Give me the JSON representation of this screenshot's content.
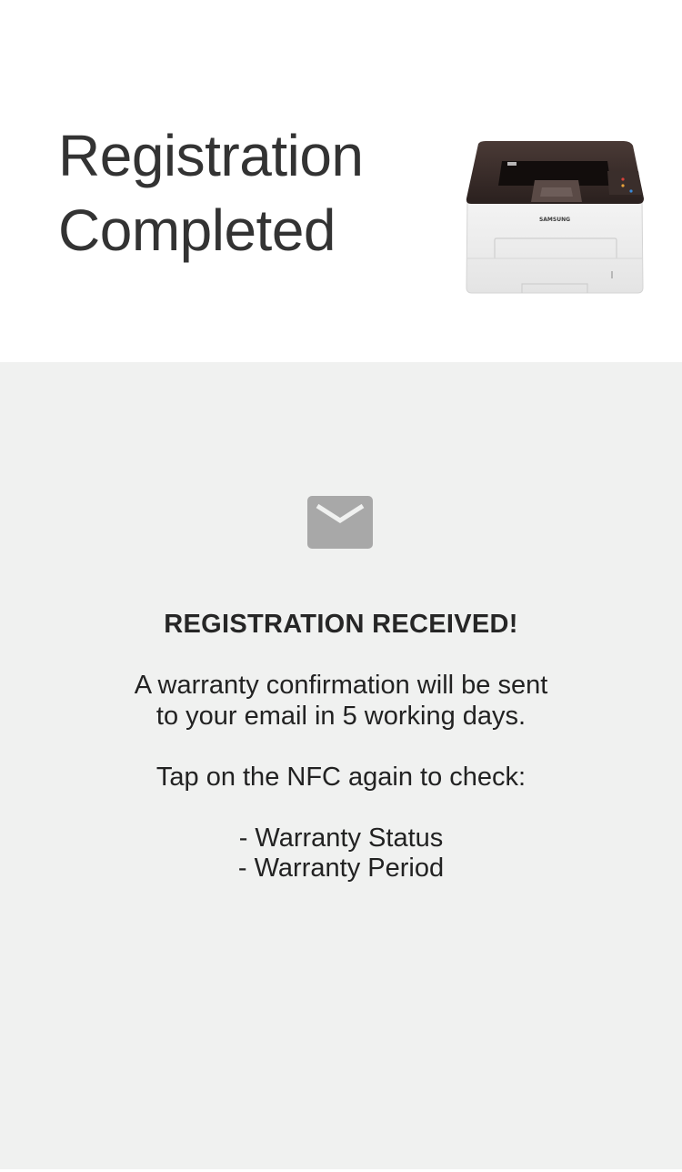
{
  "header": {
    "title_line1": "Registration",
    "title_line2": "Completed",
    "printer_image": {
      "icon": "printer-image",
      "brand_text": "SAMSUNG"
    }
  },
  "content": {
    "mail_icon": "mail-icon",
    "heading": "REGISTRATION RECEIVED!",
    "confirmation_line1": "A warranty confirmation will be sent",
    "confirmation_line2": "to your email in 5 working days.",
    "nfc_prompt": "Tap on the NFC again to check:",
    "check_items": [
      "- Warranty Status",
      "- Warranty Period"
    ]
  },
  "colors": {
    "header_background": "#ffffff",
    "content_background": "#f0f1f0",
    "title_text": "#333333",
    "body_text": "#222222",
    "icon_gray": "#a8a8a8"
  }
}
